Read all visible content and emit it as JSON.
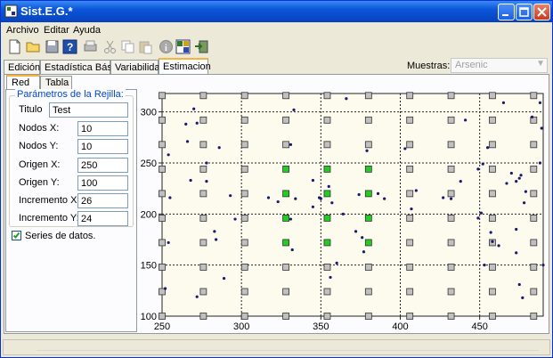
{
  "window": {
    "title": "Sist.E.G.*"
  },
  "menu": [
    "Archivo",
    "Editar",
    "Ayuda"
  ],
  "toolbar_icons": [
    "new-file-icon",
    "open-folder-icon",
    "save-icon",
    "help-icon",
    "print-icon",
    "cut-icon",
    "copy-icon",
    "paste-icon",
    "info-icon",
    "grid-icon",
    "exit-icon"
  ],
  "tabs": [
    "Edición",
    "Estadística Básica",
    "Variabilidad",
    "Estimacion"
  ],
  "active_tab": "Estimacion",
  "muestras": {
    "label": "Muestras:",
    "value": "Arsenic"
  },
  "subtabs": [
    "Red",
    "Tabla"
  ],
  "grid_params": {
    "title": "Parámetros de la Rejilla:",
    "titulo_label": "Titulo",
    "titulo_value": "Test",
    "fields": [
      {
        "label": "Nodos X:",
        "value": "10"
      },
      {
        "label": "Nodos Y:",
        "value": "10"
      },
      {
        "label": "Origen X:",
        "value": "250"
      },
      {
        "label": "Origen Y:",
        "value": "100"
      },
      {
        "label": "Incremento X:",
        "value": "26"
      },
      {
        "label": "Incremento Y:",
        "value": "24"
      }
    ],
    "series_label": "Series de datos.",
    "series_checked": true
  },
  "chart_data": {
    "type": "scatter",
    "xlim": [
      250,
      490
    ],
    "ylim": [
      100,
      318
    ],
    "xticks": [
      250,
      300,
      350,
      400,
      450
    ],
    "yticks": [
      100,
      150,
      200,
      250,
      300
    ],
    "grid": true,
    "colors": {
      "node": "#c0c0c0",
      "node_active": "#22cc22",
      "point": "#1a1a6e",
      "background": "#fcfbee"
    },
    "nodes": {
      "x0": 250,
      "y0": 100,
      "dx": 26,
      "dy": 24,
      "nx": 10,
      "ny": 10
    },
    "active_nodes": [
      [
        328,
        196
      ],
      [
        354,
        196
      ],
      [
        380,
        196
      ],
      [
        328,
        172
      ],
      [
        354,
        172
      ],
      [
        380,
        172
      ],
      [
        328,
        220
      ],
      [
        354,
        220
      ],
      [
        380,
        220
      ],
      [
        380,
        244
      ],
      [
        354,
        244
      ],
      [
        328,
        244
      ]
    ],
    "points": [
      [
        254,
        172
      ],
      [
        252,
        127
      ],
      [
        254,
        258
      ],
      [
        255,
        216
      ],
      [
        265,
        288
      ],
      [
        270,
        303
      ],
      [
        272,
        289
      ],
      [
        266,
        271
      ],
      [
        268,
        233
      ],
      [
        278,
        232
      ],
      [
        272,
        119
      ],
      [
        283,
        183
      ],
      [
        284,
        175
      ],
      [
        289,
        137
      ],
      [
        293,
        218
      ],
      [
        296,
        195
      ],
      [
        278,
        250
      ],
      [
        286,
        265
      ],
      [
        317,
        216
      ],
      [
        323,
        212
      ],
      [
        333,
        302
      ],
      [
        331,
        268
      ],
      [
        334,
        215
      ],
      [
        331,
        195
      ],
      [
        332,
        165
      ],
      [
        345,
        233
      ],
      [
        345,
        207
      ],
      [
        349,
        216
      ],
      [
        350,
        215
      ],
      [
        355,
        227
      ],
      [
        357,
        211
      ],
      [
        356,
        138
      ],
      [
        360,
        152
      ],
      [
        366,
        313
      ],
      [
        364,
        200
      ],
      [
        372,
        183
      ],
      [
        376,
        177
      ],
      [
        379,
        262
      ],
      [
        374,
        219
      ],
      [
        377,
        163
      ],
      [
        386,
        220
      ],
      [
        390,
        215
      ],
      [
        403,
        264
      ],
      [
        407,
        205
      ],
      [
        410,
        223
      ],
      [
        427,
        216
      ],
      [
        432,
        215
      ],
      [
        438,
        232
      ],
      [
        449,
        196
      ],
      [
        451,
        201
      ],
      [
        449,
        244
      ],
      [
        452,
        249
      ],
      [
        455,
        265
      ],
      [
        457,
        182
      ],
      [
        462,
        169
      ],
      [
        465,
        309
      ],
      [
        467,
        230
      ],
      [
        473,
        232
      ],
      [
        476,
        238
      ],
      [
        478,
        211
      ],
      [
        479,
        222
      ],
      [
        483,
        295
      ],
      [
        475,
        235
      ],
      [
        488,
        309
      ],
      [
        489,
        284
      ],
      [
        488,
        250
      ],
      [
        490,
        150
      ],
      [
        458,
        173
      ],
      [
        475,
        131
      ],
      [
        477,
        118
      ],
      [
        473,
        162
      ],
      [
        473,
        185
      ],
      [
        441,
        292
      ],
      [
        470,
        240
      ],
      [
        453,
        150
      ]
    ]
  }
}
